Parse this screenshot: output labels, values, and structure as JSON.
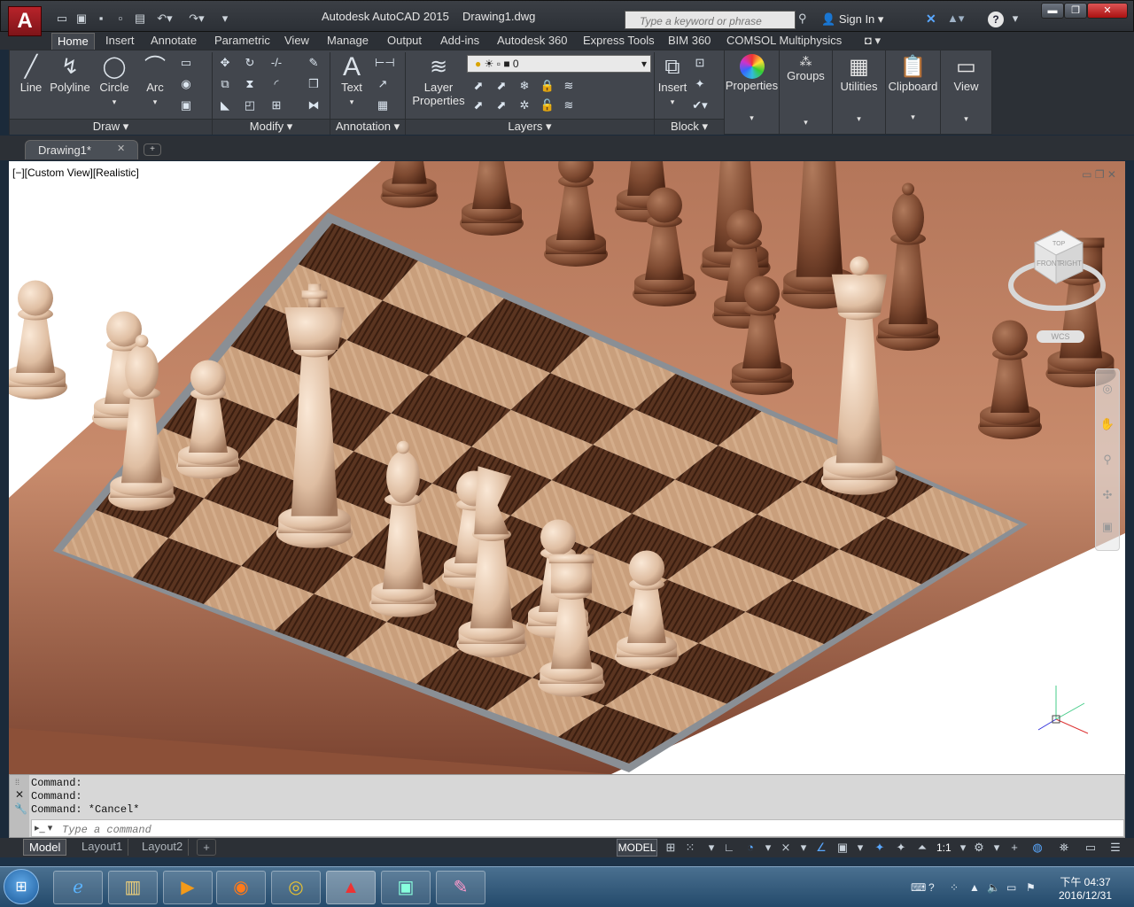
{
  "title": {
    "app": "Autodesk AutoCAD 2015",
    "document": "Drawing1.dwg"
  },
  "search": {
    "placeholder": "Type a keyword or phrase"
  },
  "account": {
    "signin_label": "Sign In"
  },
  "tabs": [
    "Home",
    "Insert",
    "Annotate",
    "Parametric",
    "View",
    "Manage",
    "Output",
    "Add-ins",
    "Autodesk 360",
    "Express Tools",
    "BIM 360",
    "COMSOL Multiphysics"
  ],
  "draw_panel": {
    "title": "Draw",
    "tools": [
      "Line",
      "Polyline",
      "Circle",
      "Arc"
    ]
  },
  "modify_panel": {
    "title": "Modify"
  },
  "annotation_panel": {
    "title": "Annotation",
    "text_label": "Text"
  },
  "layers_panel": {
    "title": "Layers",
    "layer_props_label_1": "Layer",
    "layer_props_label_2": "Properties",
    "current_layer": "0"
  },
  "block_panel": {
    "title": "Block",
    "insert_label": "Insert"
  },
  "properties_btn": "Properties",
  "groups_btn": "Groups",
  "utilities_btn": "Utilities",
  "clipboard_btn": "Clipboard",
  "view_btn": "View",
  "doc_tab": {
    "label": "Drawing1*"
  },
  "viewport": {
    "label": "[−][Custom View][Realistic]",
    "viewcube_top": "TOP",
    "viewcube_front": "FRONT",
    "viewcube_right": "RIGHT",
    "ucs_label": "WCS"
  },
  "command": {
    "history": [
      "Command:",
      "Command:",
      "Command: *Cancel*"
    ],
    "placeholder": "Type a command"
  },
  "layout_tabs": [
    "Model",
    "Layout1",
    "Layout2"
  ],
  "status": {
    "model_label": "MODEL",
    "scale": "1:1"
  },
  "taskbar": {
    "time": "下午 04:37",
    "date": "2016/12/31"
  },
  "colors": {
    "accent": "#b8232a",
    "light_square": "#caa37f",
    "dark_square": "#5a3420",
    "frame": "#a8674b",
    "white_piece": "#e6c8ad",
    "dark_piece": "#7e4a31"
  }
}
